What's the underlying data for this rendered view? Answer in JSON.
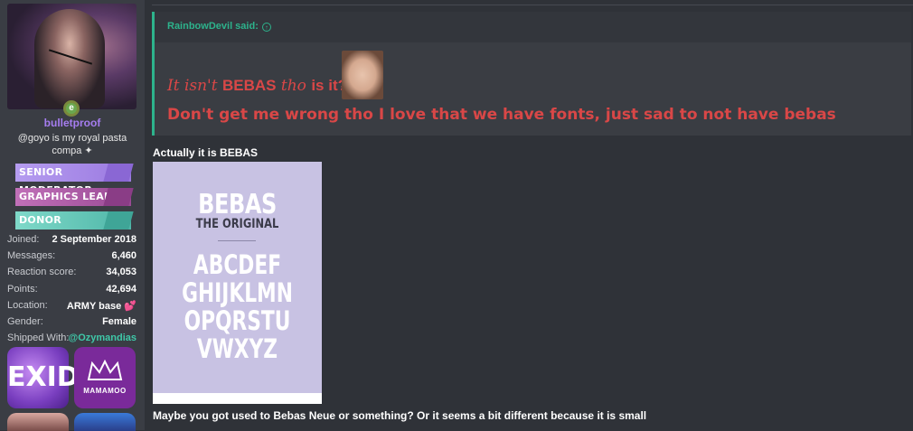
{
  "user": {
    "username": "bulletproof",
    "title": "@goyo is my royal pasta compa ✦",
    "online_badge": "e",
    "banners": [
      "SENIOR MODERATOR",
      "GRAPHICS LEAD",
      "DONOR"
    ],
    "stats": [
      {
        "label": "Joined:",
        "value": "2 September 2018"
      },
      {
        "label": "Messages:",
        "value": "6,460"
      },
      {
        "label": "Reaction score:",
        "value": "34,053"
      },
      {
        "label": "Points:",
        "value": "42,694"
      },
      {
        "label": "Location:",
        "value": "ARMY base 💕"
      },
      {
        "label": "Gender:",
        "value": "Female"
      },
      {
        "label": "Shipped With:",
        "value": "@Ozymandias"
      }
    ],
    "badge_exid": "EXID",
    "badge_mamamoo": "MAMAMOO"
  },
  "quote": {
    "author": "RainbowDevil said:",
    "arrow_icon": "↑",
    "line1_script": "It isn't ",
    "line1_bold": "BEBAS",
    "line1_script2": " tho ",
    "line1_end": "is it?",
    "line2": "Don't get me wrong tho I love that we have fonts, just sad to not have bebas"
  },
  "post": {
    "line1": "Actually it is BEBAS",
    "line2": "Maybe you got used to Bebas Neue or something? Or it seems a bit different because it is small"
  },
  "font_card": {
    "title": "BEBAS",
    "subtitle": "THE ORIGINAL",
    "letters": [
      "ABCDEF",
      "GHIJKLMN",
      "OPQRSTU",
      "VWXYZ"
    ]
  },
  "colors": {
    "background": "#2f3238",
    "sidebar": "#3a3d44",
    "accent_green": "#2db38c",
    "quote_red": "#d94747",
    "username_purple": "#a67df0",
    "card_lavender": "#c8c2e3"
  }
}
